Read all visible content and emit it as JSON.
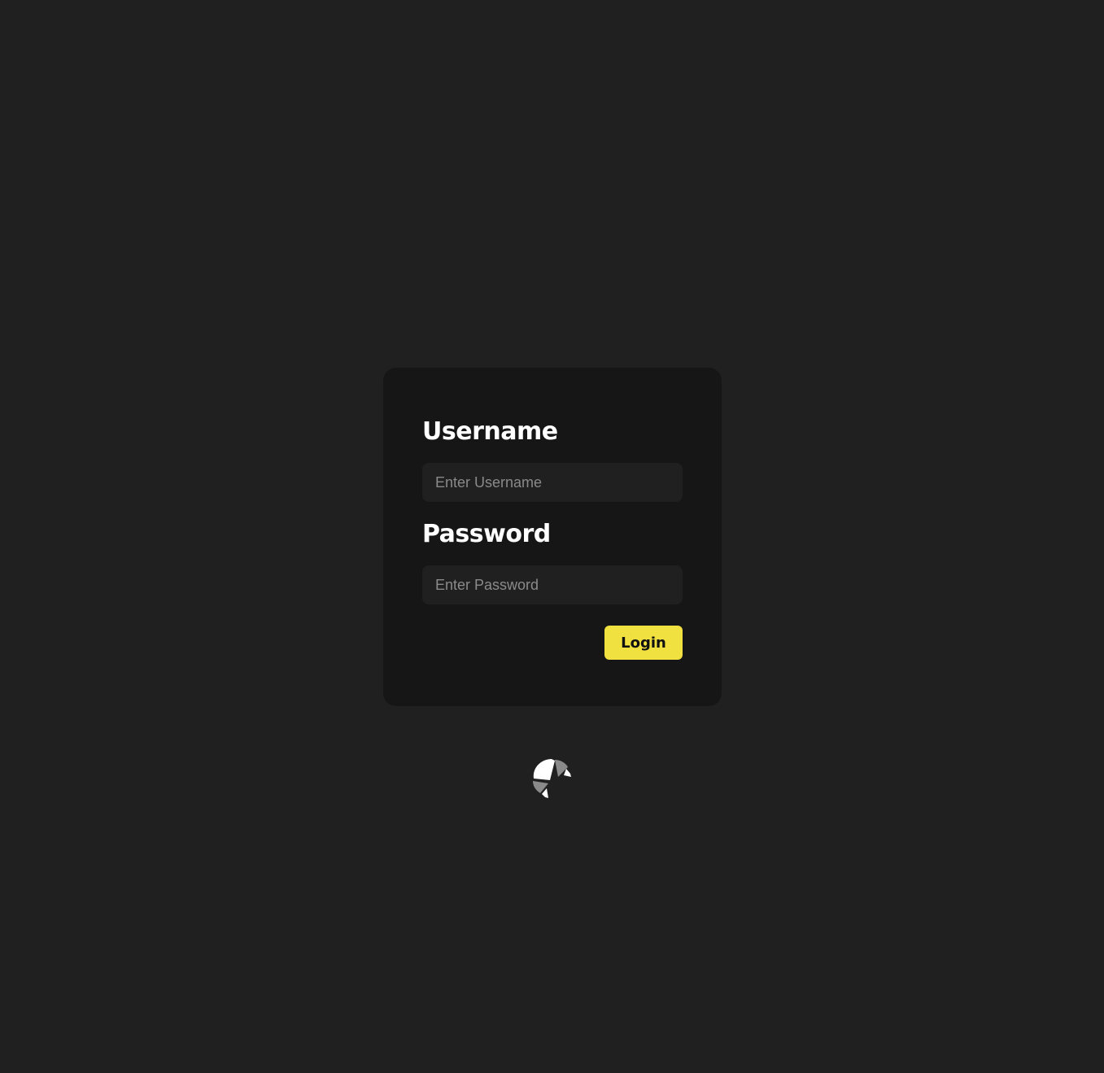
{
  "form": {
    "username_label": "Username",
    "username_placeholder": "Enter Username",
    "password_label": "Password",
    "password_placeholder": "Enter Password",
    "login_label": "Login"
  },
  "logo": {
    "icon": "croissant-icon"
  },
  "colors": {
    "background": "#202020",
    "card": "#161616",
    "input": "#202020",
    "accent": "#f0e040"
  }
}
